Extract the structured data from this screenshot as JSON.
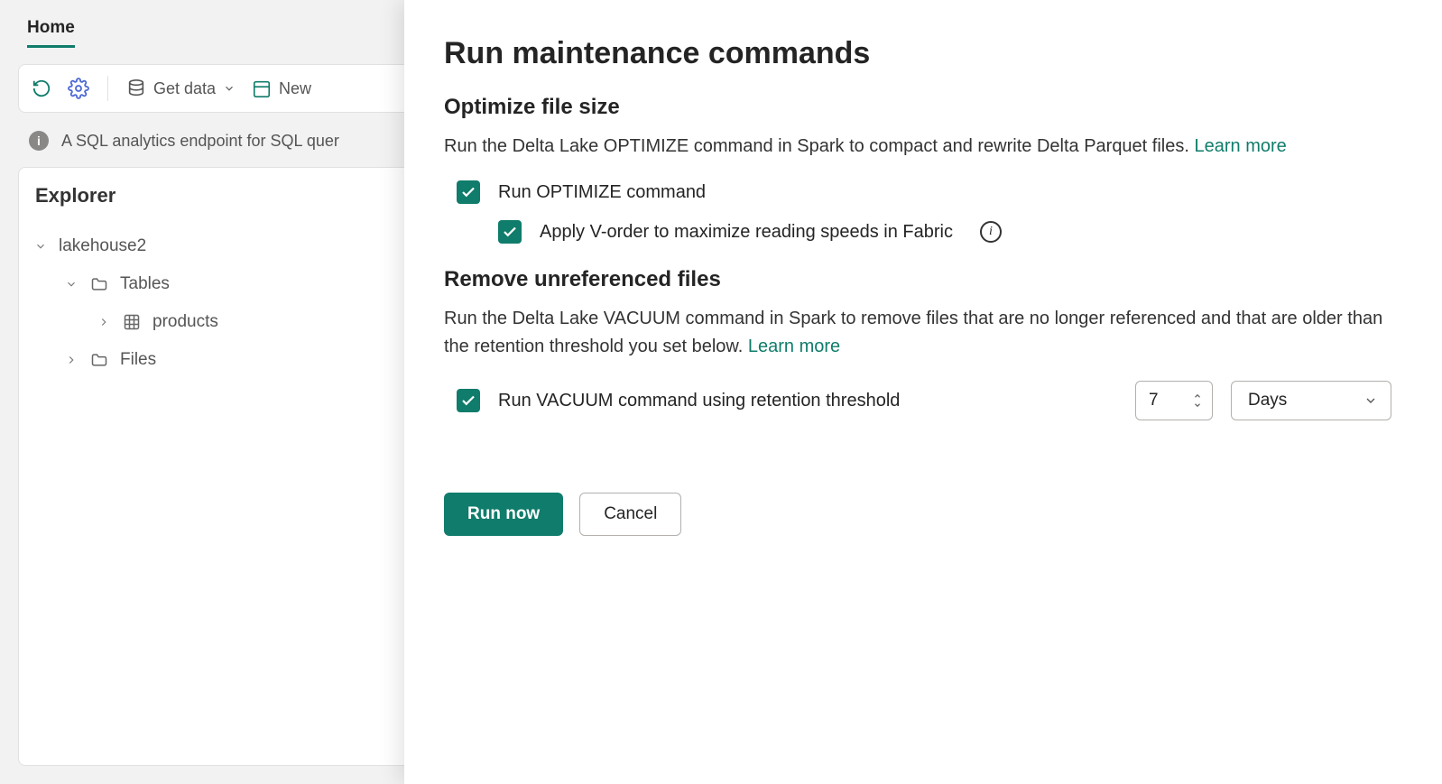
{
  "colors": {
    "accent": "#107c6b"
  },
  "tabs": {
    "home": "Home"
  },
  "toolbar": {
    "refresh_name": "refresh-icon",
    "settings_name": "gear-icon",
    "getdata_label": "Get data",
    "new_label": "New"
  },
  "infobar": {
    "text": "A SQL analytics endpoint for SQL quer"
  },
  "explorer": {
    "title": "Explorer",
    "root": "lakehouse2",
    "tables_label": "Tables",
    "items": [
      {
        "label": "products"
      }
    ],
    "files_label": "Files"
  },
  "panel": {
    "title": "Run maintenance commands",
    "optimize": {
      "heading": "Optimize file size",
      "desc_prefix": "Run the Delta Lake OPTIMIZE command in Spark to compact and rewrite Delta Parquet files. ",
      "learn_more": "Learn more",
      "check1": "Run OPTIMIZE command",
      "check2": "Apply V-order to maximize reading speeds in Fabric"
    },
    "vacuum": {
      "heading": "Remove unreferenced files",
      "desc_prefix": "Run the Delta Lake VACUUM command in Spark to remove files that are no longer referenced and that are older than the retention threshold you set below. ",
      "learn_more": "Learn more",
      "check_label": "Run VACUUM command using retention threshold",
      "value": "7",
      "unit": "Days"
    },
    "footer": {
      "run": "Run now",
      "cancel": "Cancel"
    }
  }
}
